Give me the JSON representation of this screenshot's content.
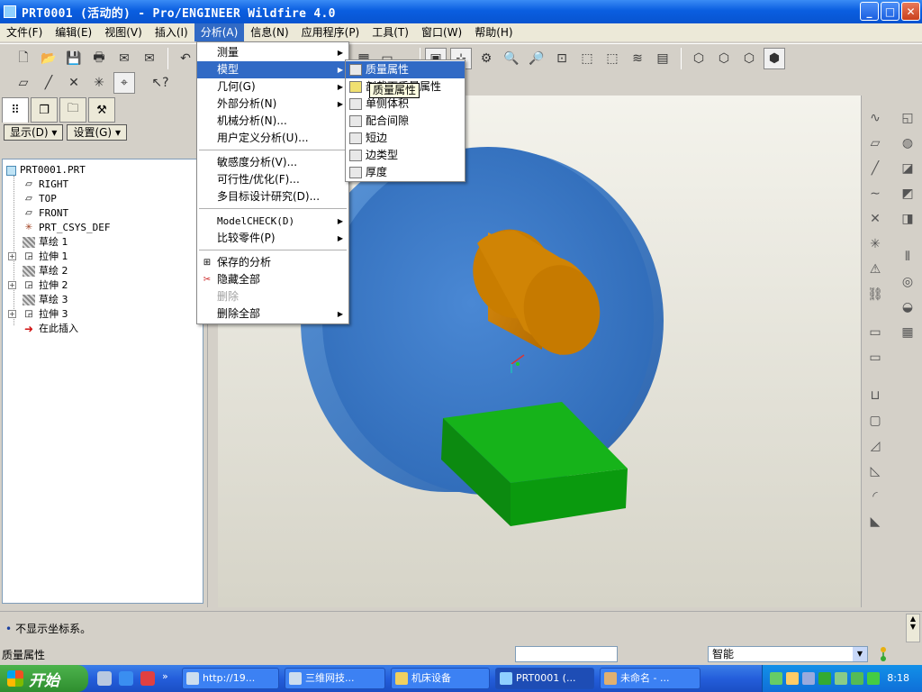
{
  "window": {
    "title": "PRT0001 (活动的) - Pro/ENGINEER Wildfire 4.0",
    "controls": {
      "minimize": "_",
      "maximize": "□",
      "close": "✕"
    }
  },
  "menubar": [
    {
      "label": "文件(F)"
    },
    {
      "label": "编辑(E)"
    },
    {
      "label": "视图(V)"
    },
    {
      "label": "插入(I)"
    },
    {
      "label": "分析(A)",
      "active": true
    },
    {
      "label": "信息(N)"
    },
    {
      "label": "应用程序(P)"
    },
    {
      "label": "工具(T)"
    },
    {
      "label": "窗口(W)"
    },
    {
      "label": "帮助(H)"
    }
  ],
  "analysis_menu": {
    "items": [
      {
        "label": "测量",
        "submenu": true
      },
      {
        "label": "模型",
        "submenu": true,
        "highlighted": true
      },
      {
        "label": "几何(G)",
        "submenu": true
      },
      {
        "label": "外部分析(N)",
        "submenu": true
      },
      {
        "label": "机械分析(N)..."
      },
      {
        "label": "用户定义分析(U)..."
      },
      {
        "label": "敏感度分析(V)..."
      },
      {
        "label": "可行性/优化(F)..."
      },
      {
        "label": "多目标设计研究(D)..."
      },
      {
        "label": "ModelCHECK(D)",
        "submenu": true
      },
      {
        "label": "比较零件(P)",
        "submenu": true
      },
      {
        "label": "保存的分析",
        "icon": "saved-analysis-icon"
      },
      {
        "label": "隐藏全部",
        "icon": "hide-all-icon"
      },
      {
        "label": "删除",
        "disabled": true
      },
      {
        "label": "删除全部",
        "submenu": true
      }
    ]
  },
  "model_submenu": {
    "items": [
      {
        "label": "质量属性",
        "highlighted": true,
        "icon": "mass-properties-icon"
      },
      {
        "label": "剖截面质量属性",
        "icon": "xsection-mass-icon"
      },
      {
        "label": "单侧体积",
        "icon": "one-side-volume-icon"
      },
      {
        "label": "配合间隙",
        "icon": "pairs-clearance-icon"
      },
      {
        "label": "短边",
        "icon": "short-edge-icon"
      },
      {
        "label": "边类型",
        "icon": "edge-type-icon"
      },
      {
        "label": "厚度",
        "icon": "thickness-icon"
      }
    ],
    "tooltip": "质量属性"
  },
  "left_panel": {
    "tabs": [
      "model-tree-icon",
      "layer-tree-icon",
      "folder-icon",
      "favorites-icon"
    ],
    "display_button": "显示(D)",
    "settings_button": "设置(G)",
    "tree": [
      {
        "label": "PRT0001.PRT",
        "icon": "part-icon",
        "level": 0
      },
      {
        "label": "RIGHT",
        "icon": "datum-plane-icon",
        "level": 1
      },
      {
        "label": "TOP",
        "icon": "datum-plane-icon",
        "level": 1
      },
      {
        "label": "FRONT",
        "icon": "datum-plane-icon",
        "level": 1
      },
      {
        "label": "PRT_CSYS_DEF",
        "icon": "csys-icon",
        "level": 1
      },
      {
        "label": "草绘 1",
        "icon": "sketch-icon",
        "level": 1
      },
      {
        "label": "拉伸 1",
        "icon": "extrude-icon",
        "level": 1,
        "expandable": true
      },
      {
        "label": "草绘 2",
        "icon": "sketch-icon",
        "level": 1
      },
      {
        "label": "拉伸 2",
        "icon": "extrude-icon",
        "level": 1,
        "expandable": true
      },
      {
        "label": "草绘 3",
        "icon": "sketch-icon",
        "level": 1
      },
      {
        "label": "拉伸 3",
        "icon": "extrude-icon",
        "level": 1,
        "expandable": true
      },
      {
        "label": "在此插入",
        "icon": "insert-here-arrow-icon",
        "level": 1
      }
    ]
  },
  "message": "不显示坐标系。",
  "status": {
    "prompt": "质量属性",
    "filter": "智能"
  },
  "taskbar": {
    "start": "开始",
    "tasks": [
      {
        "label": "http://19..."
      },
      {
        "label": "三维网技..."
      },
      {
        "label": "机床设备"
      },
      {
        "label": "PRT0001 (..."
      },
      {
        "label": "未命名 - ..."
      }
    ],
    "clock": "8:18"
  },
  "colors": {
    "title_blue": "#0a5ee0",
    "menu_highlight": "#316ac5",
    "body_blue": "#3d7fd0",
    "boss_orange": "#c77b00",
    "block_green": "#0e9a10"
  }
}
